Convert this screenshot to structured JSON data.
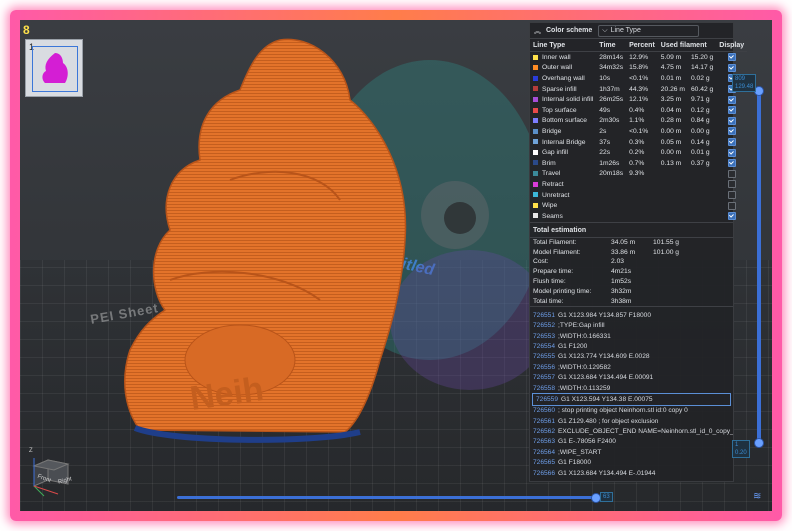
{
  "viewport": {
    "corner_label": "8",
    "thumbnail_number": "1",
    "bed_text": "PEI Sheet",
    "plate_name": "Untitled",
    "model_text": "Neih",
    "axes": {
      "z": "Z",
      "left": "Front",
      "right": "Right"
    }
  },
  "panel": {
    "header_label": "Color scheme",
    "color_scheme_value": "Line Type",
    "columns": [
      "Line Type",
      "Time",
      "Percent",
      "Used filament",
      "Display"
    ],
    "rows": [
      {
        "name": "Inner wall",
        "time": "28m14s",
        "percent": "12.9%",
        "len": "5.09 m",
        "weight": "15.20 g",
        "color": "#ffe14a",
        "display": true
      },
      {
        "name": "Outer wall",
        "time": "34m32s",
        "percent": "15.8%",
        "len": "4.75 m",
        "weight": "14.17 g",
        "color": "#ff8c24",
        "display": true
      },
      {
        "name": "Overhang wall",
        "time": "10s",
        "percent": "<0.1%",
        "len": "0.01 m",
        "weight": "0.02 g",
        "color": "#2a3cd8",
        "display": true
      },
      {
        "name": "Sparse infill",
        "time": "1h37m",
        "percent": "44.3%",
        "len": "20.26 m",
        "weight": "60.42 g",
        "color": "#b43c3c",
        "display": true
      },
      {
        "name": "Internal solid infill",
        "time": "26m25s",
        "percent": "12.1%",
        "len": "3.25 m",
        "weight": "9.71 g",
        "color": "#a54ed8",
        "display": true
      },
      {
        "name": "Top surface",
        "time": "49s",
        "percent": "0.4%",
        "len": "0.04 m",
        "weight": "0.12 g",
        "color": "#e84a4a",
        "display": true
      },
      {
        "name": "Bottom surface",
        "time": "2m30s",
        "percent": "1.1%",
        "len": "0.28 m",
        "weight": "0.84 g",
        "color": "#7d7dff",
        "display": true
      },
      {
        "name": "Bridge",
        "time": "2s",
        "percent": "<0.1%",
        "len": "0.00 m",
        "weight": "0.00 g",
        "color": "#5a8fc8",
        "display": true
      },
      {
        "name": "Internal Bridge",
        "time": "37s",
        "percent": "0.3%",
        "len": "0.05 m",
        "weight": "0.14 g",
        "color": "#6fa3d8",
        "display": true
      },
      {
        "name": "Gap infill",
        "time": "22s",
        "percent": "0.2%",
        "len": "0.00 m",
        "weight": "0.01 g",
        "color": "#ffffff",
        "display": true
      },
      {
        "name": "Brim",
        "time": "1m26s",
        "percent": "0.7%",
        "len": "0.13 m",
        "weight": "0.37 g",
        "color": "#2a4a8a",
        "display": true
      },
      {
        "name": "Travel",
        "time": "20m18s",
        "percent": "9.3%",
        "len": "",
        "weight": "",
        "color": "#3b8a9a",
        "display": false
      },
      {
        "name": "Retract",
        "time": "",
        "percent": "",
        "len": "",
        "weight": "",
        "color": "#d83cd8",
        "display": false
      },
      {
        "name": "Unretract",
        "time": "",
        "percent": "",
        "len": "",
        "weight": "",
        "color": "#3cb8d8",
        "display": false
      },
      {
        "name": "Wipe",
        "time": "",
        "percent": "",
        "len": "",
        "weight": "",
        "color": "#ffe14a",
        "display": false
      },
      {
        "name": "Seams",
        "time": "",
        "percent": "",
        "len": "",
        "weight": "",
        "color": "#e8e8e8",
        "display": true
      }
    ],
    "total_title": "Total estimation",
    "estimation": [
      {
        "label": "Total Filament:",
        "a": "34.05 m",
        "b": "101.55 g"
      },
      {
        "label": "Model Filament:",
        "a": "33.86 m",
        "b": "101.00 g"
      },
      {
        "label": "Cost:",
        "a": "2.03",
        "b": ""
      },
      {
        "label": "Prepare time:",
        "a": "4m21s",
        "b": ""
      },
      {
        "label": "Flush time:",
        "a": "1m52s",
        "b": ""
      },
      {
        "label": "Model printing time:",
        "a": "3h32m",
        "b": ""
      },
      {
        "label": "Total time:",
        "a": "3h38m",
        "b": ""
      }
    ],
    "gcode": [
      {
        "ln": "726551",
        "code": "G1 X123.984 Y134.857 F18000"
      },
      {
        "ln": "726552",
        "code": ";TYPE:Gap infill"
      },
      {
        "ln": "726553",
        "code": ";WIDTH:0.166331"
      },
      {
        "ln": "726554",
        "code": "G1 F1200"
      },
      {
        "ln": "726555",
        "code": "G1 X123.774 Y134.609 E.0028"
      },
      {
        "ln": "726556",
        "code": ";WIDTH:0.129582"
      },
      {
        "ln": "726557",
        "code": "G1 X123.684 Y134.494 E.00091"
      },
      {
        "ln": "726558",
        "code": ";WIDTH:0.113259"
      },
      {
        "ln": "726559",
        "code": "G1 X123.594 Y134.38 E.00075"
      },
      {
        "ln": "726560",
        "code": "; stop printing object Neinhorn.stl id:0 copy 0"
      },
      {
        "ln": "726561",
        "code": "G1 Z129.480 ; for object exclusion"
      },
      {
        "ln": "726562",
        "code": "EXCLUDE_OBJECT_END NAME=Neinhorn.stl_id_0_copy_0"
      },
      {
        "ln": "726563",
        "code": "G1 E-.78056 F2400"
      },
      {
        "ln": "726564",
        "code": ";WIPE_START"
      },
      {
        "ln": "726565",
        "code": "G1 F18000"
      },
      {
        "ln": "726566",
        "code": "G1 X123.684 Y134.494 E-.01944"
      }
    ],
    "gcode_selected_index": 8
  },
  "sliders": {
    "vertical_top_label": "809\n129.48",
    "vertical_bottom_label": "1\n0.20",
    "horizontal_label": "63"
  },
  "colors": {
    "accent": "#3b6fd6",
    "model": "#e8772e",
    "frame": "#ff5aa8"
  }
}
